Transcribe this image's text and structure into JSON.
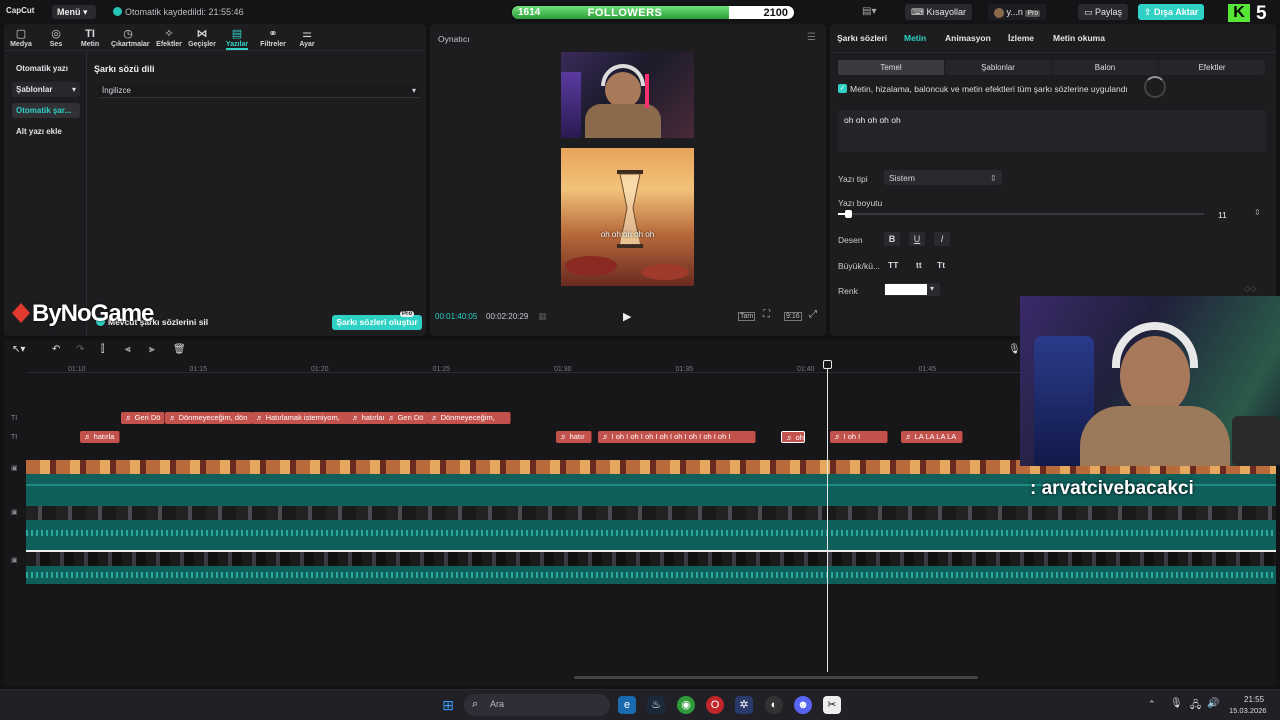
{
  "app": {
    "logo": "CapCut",
    "menu_label": "Menü",
    "autosave": "Otomatik kaydedildi: 21:55:46"
  },
  "overlay": {
    "followers_current": "1614",
    "followers_label": "FOLLOWERS",
    "followers_goal": "2100",
    "followers_progress": 0.7686,
    "kick_letter": "K",
    "kick_number": "5",
    "bynogame": "ByNoGame",
    "chat_text": ": arvatcivebacakci"
  },
  "topbar": {
    "shortcuts_label": "Kısayollar",
    "user_label": "y...n",
    "pro_badge": "Pro",
    "share_label": "Paylaş",
    "export_label": "Dışa Aktar"
  },
  "toolbar": [
    {
      "label": "Medya",
      "icon": "▢"
    },
    {
      "label": "Ses",
      "icon": "◎"
    },
    {
      "label": "Metin",
      "icon": "TI"
    },
    {
      "label": "Çıkartmalar",
      "icon": "◷"
    },
    {
      "label": "Efektler",
      "icon": "✧"
    },
    {
      "label": "Geçişler",
      "icon": "⋈"
    },
    {
      "label": "Yazılar",
      "icon": "▤"
    },
    {
      "label": "Filtreler",
      "icon": "⚭"
    },
    {
      "label": "Ayar",
      "icon": "⚌"
    }
  ],
  "sidebar": {
    "items": [
      {
        "label": "Otomatik yazı"
      },
      {
        "label": "Şablonlar"
      },
      {
        "label": "Otomatik şar..."
      },
      {
        "label": "Alt yazı ekle"
      }
    ]
  },
  "lyrics": {
    "heading": "Şarkı sözü dili",
    "language": "İngilizce",
    "delete_label": "Mevcut şarkı sözlerini sil",
    "generate_label": "Şarkı sözleri oluştur",
    "pro_badge": "Pro"
  },
  "player": {
    "title": "Oynatıcı",
    "current_time": "00:01:40:05",
    "total_time": "00:02:20:29",
    "caption": "oh oh oh oh oh",
    "btn_full": "Tam",
    "ratio": "9:16"
  },
  "inspector": {
    "tabs": [
      "Şarkı sözleri",
      "Metin",
      "Animasyon",
      "İzleme",
      "Metin okuma"
    ],
    "subtabs": [
      "Temel",
      "Şablonlar",
      "Balon",
      "Efektler"
    ],
    "apply_all": "Metin, hizalama, baloncuk ve metin efektleri tüm şarkı sözlerine uygulandı",
    "text_value": "oh oh oh oh oh",
    "font_label": "Yazı tipi",
    "font_value": "Sistem",
    "size_label": "Yazı boyutu",
    "size_value": "11",
    "style_label": "Desen",
    "style_b": "B",
    "style_u": "U",
    "style_i": "I",
    "case_label": "Büyük/kü...",
    "case_upper": "TT",
    "case_lower": "tt",
    "case_title": "Tt",
    "color_label": "Renk",
    "color_value": "#ffffff"
  },
  "timeline": {
    "ticks": [
      "01:10",
      "01:15",
      "01:20",
      "01:25",
      "01:30",
      "01:35",
      "01:40",
      "01:45"
    ],
    "row1": [
      {
        "label": "Geri Dö"
      },
      {
        "label": "Dönmeyeceğim, dön"
      },
      {
        "label": "Hatırlamak istemiyom,"
      },
      {
        "label": "hatırlamak"
      },
      {
        "label": "Geri Dö"
      },
      {
        "label": "Dönmeyeceğim,"
      }
    ],
    "row2": [
      {
        "label": "hatırla"
      },
      {
        "label": "hatır"
      },
      {
        "label": "I oh I oh I oh I oh I oh I oh I oh I oh I"
      },
      {
        "label": "oh"
      },
      {
        "label": "I oh I"
      },
      {
        "label": "LA LA LA LA"
      }
    ]
  },
  "taskbar": {
    "search_placeholder": "Ara",
    "time": "21:55",
    "date": "15.03.2026"
  },
  "colors": {
    "accent": "#2ed1c4",
    "clip_red": "#c4524c",
    "video_teal": "#0f5f5a"
  }
}
